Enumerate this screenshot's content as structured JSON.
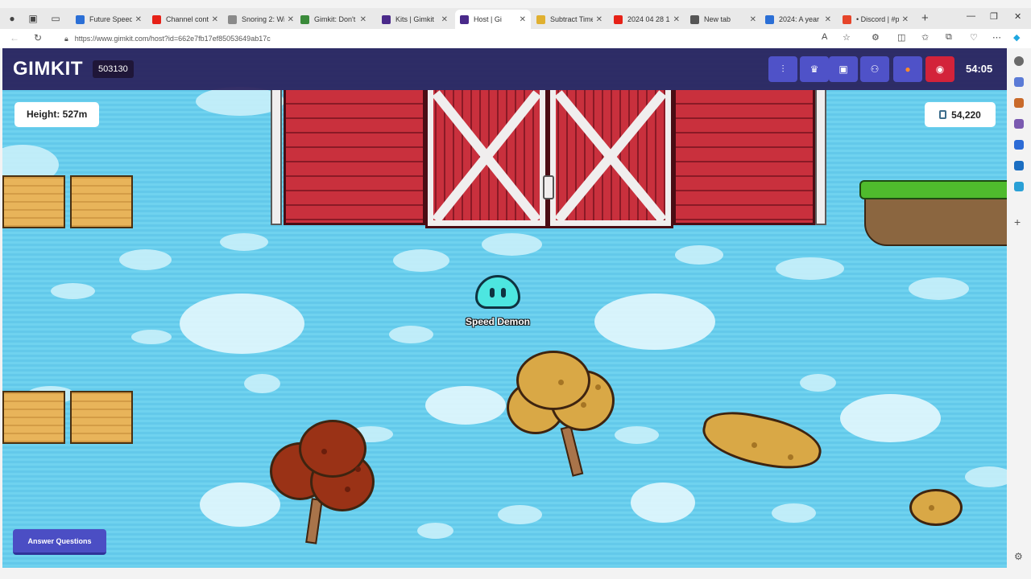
{
  "browser": {
    "tabs": [
      {
        "title": "Future Speed",
        "color": "#2b6fd6"
      },
      {
        "title": "Channel conte",
        "color": "#e62117"
      },
      {
        "title": "Snoring 2: Wil",
        "color": "#8a8a8a"
      },
      {
        "title": "Gimkit: Don't",
        "color": "#3a8a3a"
      },
      {
        "title": "Kits | Gimkit",
        "color": "#4a2a8a"
      },
      {
        "title": "Host | Gi",
        "color": "#4a2a8a"
      },
      {
        "title": "Subtract Time",
        "color": "#e0b030"
      },
      {
        "title": "2024 04 28 12",
        "color": "#e62117"
      },
      {
        "title": "New tab",
        "color": "#555555"
      },
      {
        "title": "2024: A year i",
        "color": "#2b6fd6"
      },
      {
        "title": "• Discord | #p",
        "color": "#e6452a"
      }
    ],
    "active_tab_index": 5,
    "url": "https://www.gimkit.com/host?id=662e7fb17ef85053649ab17c"
  },
  "game": {
    "logo": "GIMKIT",
    "code": "503130",
    "timer": "54:05",
    "height_label": "Height: 527m",
    "money": "54,220",
    "player_name": "Speed Demon",
    "answer_button": "Answer Questions",
    "header_buttons": [
      "waveform-icon",
      "trophy-icon",
      "lock-icon",
      "players-icon",
      "pumpkin-icon",
      "record-icon"
    ],
    "colors": {
      "header_bg": "#281e5a",
      "button_blue": "#4f52c8",
      "button_red": "#d3233a",
      "sky": "#6fd2ef",
      "player": "#4de6e0"
    }
  }
}
